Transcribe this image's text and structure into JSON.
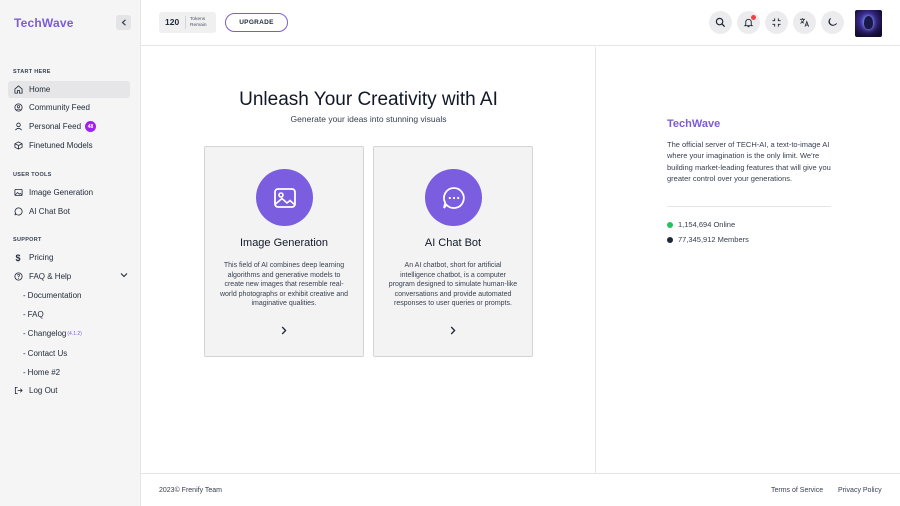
{
  "brand": {
    "name": "TechWave",
    "accent": "#7c5cd6"
  },
  "sidebar": {
    "sections": [
      {
        "label": "START HERE"
      },
      {
        "label": "USER TOOLS"
      },
      {
        "label": "SUPPORT"
      }
    ],
    "items": [
      {
        "label": "Home",
        "icon": "home-icon",
        "active": true
      },
      {
        "label": "Community Feed",
        "icon": "community-icon"
      },
      {
        "label": "Personal Feed",
        "icon": "user-icon",
        "badge": "48"
      },
      {
        "label": "Finetuned Models",
        "icon": "cube-icon"
      },
      {
        "label": "Image Generation",
        "icon": "image-icon"
      },
      {
        "label": "AI Chat Bot",
        "icon": "chat-icon"
      },
      {
        "label": "Pricing",
        "icon": "dollar-icon"
      },
      {
        "label": "FAQ & Help",
        "icon": "help-icon"
      },
      {
        "label": "Log Out",
        "icon": "logout-icon"
      }
    ],
    "sub_items": [
      {
        "label": "Documentation"
      },
      {
        "label": "FAQ"
      },
      {
        "label": "Changelog",
        "version": "(4.1.2)"
      },
      {
        "label": "Contact Us"
      },
      {
        "label": "Home #2"
      }
    ]
  },
  "topbar": {
    "tokens_count": "120",
    "tokens_label_1": "Tokens",
    "tokens_label_2": "Remain",
    "upgrade_label": "UPGRADE",
    "buttons": [
      "search-icon",
      "bell-icon",
      "fullscreen-icon",
      "translate-icon",
      "moon-icon"
    ]
  },
  "hero": {
    "title": "Unleash Your Creativity with AI",
    "subtitle": "Generate your ideas into stunning visuals"
  },
  "cards": [
    {
      "title": "Image Generation",
      "icon": "image-icon",
      "description": "This field of AI combines deep learning algorithms and generative models to create new images that resemble real-world photographs or exhibit creative and imaginative qualities."
    },
    {
      "title": "AI Chat Bot",
      "icon": "chat-bubble-icon",
      "description": "An AI chatbot, short for artificial intelligence chatbot, is a computer program designed to simulate human-like conversations and provide automated responses to user queries or prompts."
    }
  ],
  "aside": {
    "logo": "TechWave",
    "description": "The official server of TECH-AI, a text-to-image AI where your imagination is the only limit. We're building market-leading features that will give you greater control over your generations.",
    "stats": [
      {
        "text": "1,154,694 Online",
        "color": "#22c55e"
      },
      {
        "text": "77,345,912 Members",
        "color": "#1f2937"
      }
    ]
  },
  "footer": {
    "copyright": "2023© Frenify Team",
    "links": [
      "Terms of Service",
      "Privacy Policy"
    ]
  }
}
